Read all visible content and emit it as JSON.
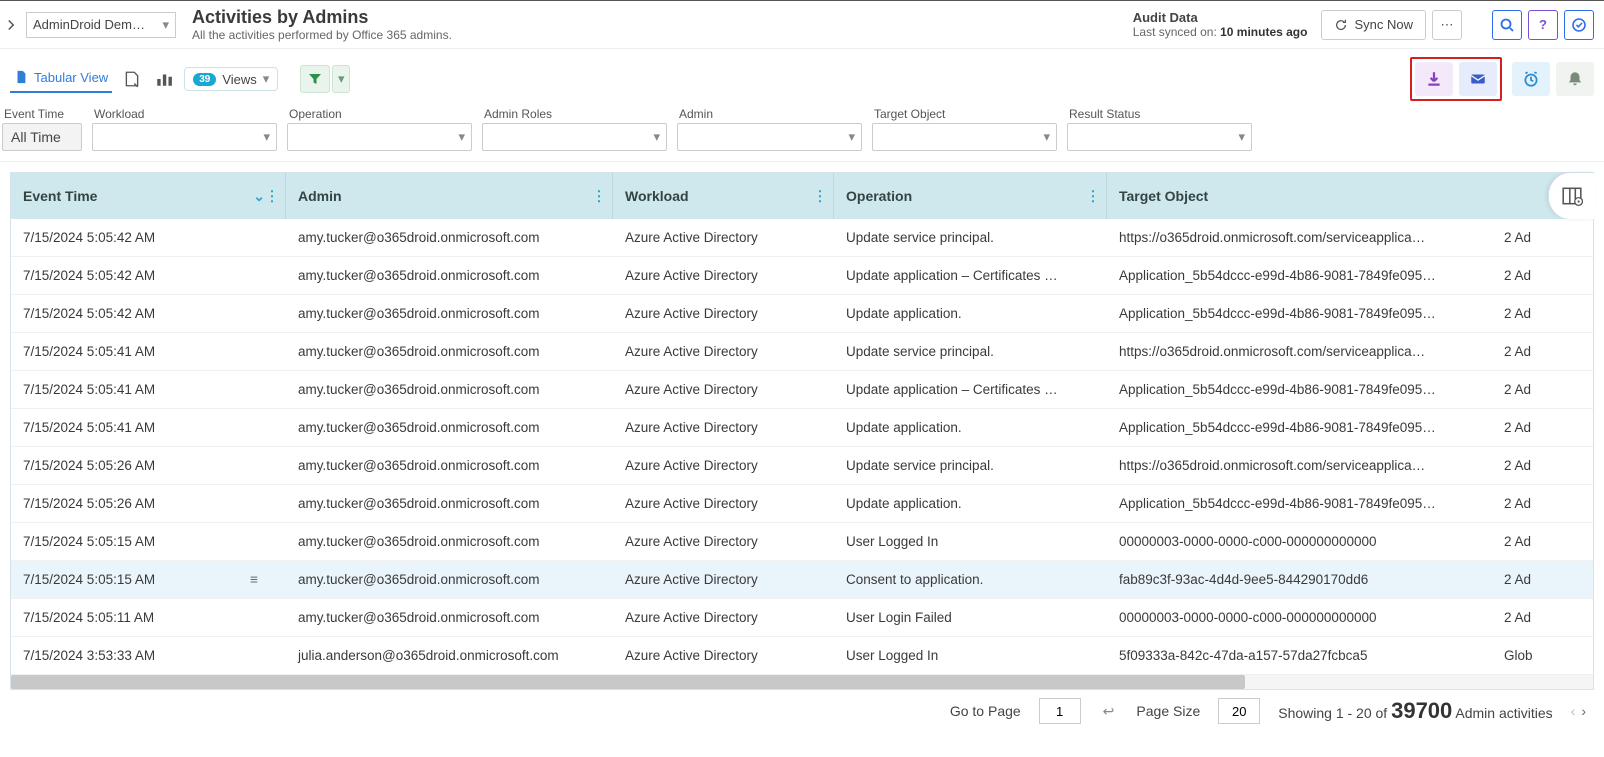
{
  "org_selector": "AdminDroid Dem…",
  "page": {
    "title": "Activities by Admins",
    "subtitle": "All the activities performed by Office 365 admins."
  },
  "audit": {
    "title": "Audit Data",
    "synced_prefix": "Last synced on: ",
    "synced_value": "10 minutes ago",
    "sync_btn": "Sync Now"
  },
  "toolbar": {
    "tab_label": "Tabular View",
    "views_count": "39",
    "views_label": "Views"
  },
  "filters": {
    "event_time": {
      "label": "Event Time",
      "value": "All Time"
    },
    "workload": {
      "label": "Workload"
    },
    "operation": {
      "label": "Operation"
    },
    "admin_roles": {
      "label": "Admin Roles"
    },
    "admin": {
      "label": "Admin"
    },
    "target": {
      "label": "Target Object"
    },
    "result": {
      "label": "Result Status"
    }
  },
  "columns": {
    "event_time": "Event Time",
    "admin": "Admin",
    "workload": "Workload",
    "operation": "Operation",
    "target": "Target Object"
  },
  "rows": [
    {
      "time": "7/15/2024 5:05:42 AM",
      "admin": "amy.tucker@o365droid.onmicrosoft.com",
      "workload": "Azure Active Directory",
      "op": "Update service principal.",
      "target": "https://o365droid.onmicrosoft.com/serviceapplica…",
      "role": "2 Ad"
    },
    {
      "time": "7/15/2024 5:05:42 AM",
      "admin": "amy.tucker@o365droid.onmicrosoft.com",
      "workload": "Azure Active Directory",
      "op": "Update application – Certificates …",
      "target": "Application_5b54dccc-e99d-4b86-9081-7849fe095…",
      "role": "2 Ad"
    },
    {
      "time": "7/15/2024 5:05:42 AM",
      "admin": "amy.tucker@o365droid.onmicrosoft.com",
      "workload": "Azure Active Directory",
      "op": "Update application.",
      "target": "Application_5b54dccc-e99d-4b86-9081-7849fe095…",
      "role": "2 Ad"
    },
    {
      "time": "7/15/2024 5:05:41 AM",
      "admin": "amy.tucker@o365droid.onmicrosoft.com",
      "workload": "Azure Active Directory",
      "op": "Update service principal.",
      "target": "https://o365droid.onmicrosoft.com/serviceapplica…",
      "role": "2 Ad"
    },
    {
      "time": "7/15/2024 5:05:41 AM",
      "admin": "amy.tucker@o365droid.onmicrosoft.com",
      "workload": "Azure Active Directory",
      "op": "Update application – Certificates …",
      "target": "Application_5b54dccc-e99d-4b86-9081-7849fe095…",
      "role": "2 Ad"
    },
    {
      "time": "7/15/2024 5:05:41 AM",
      "admin": "amy.tucker@o365droid.onmicrosoft.com",
      "workload": "Azure Active Directory",
      "op": "Update application.",
      "target": "Application_5b54dccc-e99d-4b86-9081-7849fe095…",
      "role": "2 Ad"
    },
    {
      "time": "7/15/2024 5:05:26 AM",
      "admin": "amy.tucker@o365droid.onmicrosoft.com",
      "workload": "Azure Active Directory",
      "op": "Update service principal.",
      "target": "https://o365droid.onmicrosoft.com/serviceapplica…",
      "role": "2 Ad"
    },
    {
      "time": "7/15/2024 5:05:26 AM",
      "admin": "amy.tucker@o365droid.onmicrosoft.com",
      "workload": "Azure Active Directory",
      "op": "Update application.",
      "target": "Application_5b54dccc-e99d-4b86-9081-7849fe095…",
      "role": "2 Ad"
    },
    {
      "time": "7/15/2024 5:05:15 AM",
      "admin": "amy.tucker@o365droid.onmicrosoft.com",
      "workload": "Azure Active Directory",
      "op": "User Logged In",
      "target": "00000003-0000-0000-c000-000000000000",
      "role": "2 Ad"
    },
    {
      "time": "7/15/2024 5:05:15 AM",
      "admin": "amy.tucker@o365droid.onmicrosoft.com",
      "workload": "Azure Active Directory",
      "op": "Consent to application.",
      "target": "fab89c3f-93ac-4d4d-9ee5-844290170dd6",
      "role": "2 Ad",
      "hover": true
    },
    {
      "time": "7/15/2024 5:05:11 AM",
      "admin": "amy.tucker@o365droid.onmicrosoft.com",
      "workload": "Azure Active Directory",
      "op": "User Login Failed",
      "target": "00000003-0000-0000-c000-000000000000",
      "role": "2 Ad"
    },
    {
      "time": "7/15/2024 3:53:33 AM",
      "admin": "julia.anderson@o365droid.onmicrosoft.com",
      "workload": "Azure Active Directory",
      "op": "User Logged In",
      "target": "5f09333a-842c-47da-a157-57da27fcbca5",
      "role": "Glob"
    }
  ],
  "footer": {
    "goto_label": "Go to Page",
    "goto_value": "1",
    "pagesize_label": "Page Size",
    "pagesize_value": "20",
    "showing_prefix": "Showing 1 - 20 of ",
    "total": "39700",
    "showing_suffix": " Admin activities"
  }
}
